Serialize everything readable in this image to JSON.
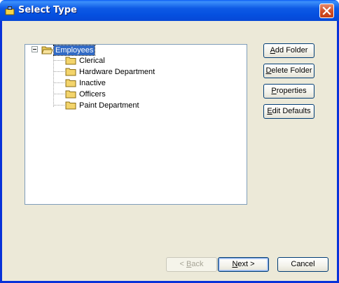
{
  "window": {
    "title": "Select Type",
    "close_symbol": "✕"
  },
  "tree": {
    "root": {
      "label": "Employees",
      "expanded": true,
      "selected": true
    },
    "children": [
      {
        "label": "Clerical"
      },
      {
        "label": "Hardware Department"
      },
      {
        "label": "Inactive"
      },
      {
        "label": "Officers"
      },
      {
        "label": "Paint Department"
      }
    ]
  },
  "side_buttons": {
    "add_folder": {
      "mnemonic": "A",
      "rest": "dd Folder"
    },
    "delete_folder": {
      "mnemonic": "D",
      "rest": "elete Folder"
    },
    "properties": {
      "mnemonic": "P",
      "rest": "roperties"
    },
    "edit_defaults": {
      "mnemonic": "E",
      "rest": "dit Defaults"
    }
  },
  "footer": {
    "back": {
      "prefix": "< ",
      "mnemonic": "B",
      "rest": "ack",
      "enabled": false
    },
    "next": {
      "mnemonic": "N",
      "rest": "ext >"
    },
    "cancel": {
      "label": "Cancel"
    }
  },
  "colors": {
    "selection": "#316ac5",
    "dialog_bg": "#ece9d8",
    "titlebar": "#0550e0"
  }
}
